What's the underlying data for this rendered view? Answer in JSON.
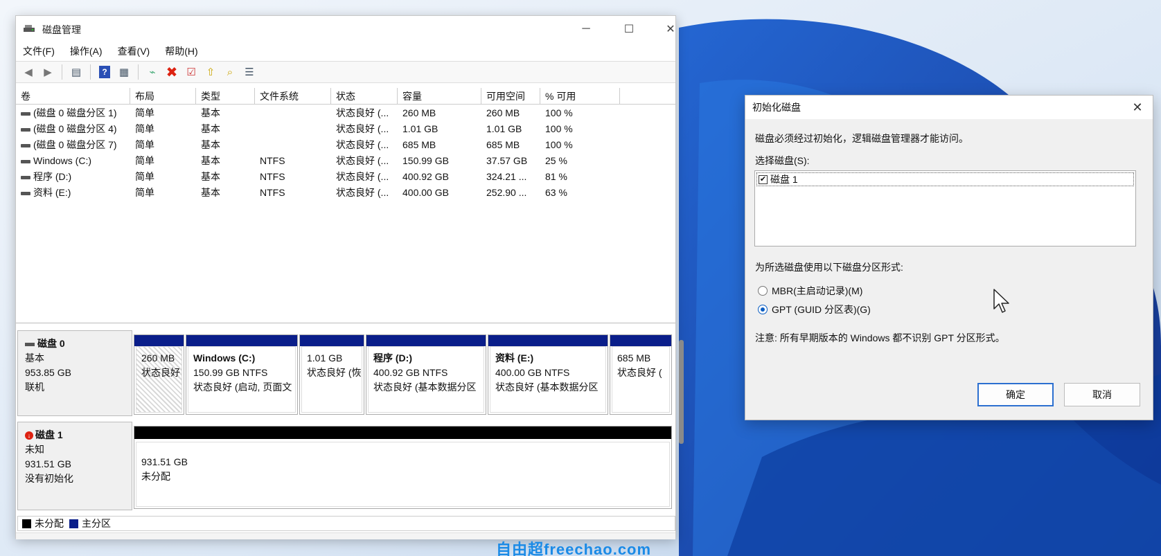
{
  "window": {
    "title": "磁盘管理",
    "controls": {
      "minimize": "─",
      "maximize": "☐",
      "close": "✕"
    }
  },
  "menu": [
    "文件(F)",
    "操作(A)",
    "查看(V)",
    "帮助(H)"
  ],
  "toolbar_icons": [
    "back-icon",
    "forward-icon",
    "console-tree-icon",
    "help-icon",
    "properties-icon",
    "connect-icon",
    "delete-icon",
    "check-icon",
    "import-icon",
    "search-icon",
    "list-icon"
  ],
  "columns": [
    "卷",
    "布局",
    "类型",
    "文件系统",
    "状态",
    "容量",
    "可用空间",
    "% 可用"
  ],
  "volumes": [
    {
      "name": "(磁盘 0 磁盘分区 1)",
      "layout": "简单",
      "type": "基本",
      "fs": "",
      "status": "状态良好 (...",
      "capacity": "260 MB",
      "free": "260 MB",
      "pct": "100 %"
    },
    {
      "name": "(磁盘 0 磁盘分区 4)",
      "layout": "简单",
      "type": "基本",
      "fs": "",
      "status": "状态良好 (...",
      "capacity": "1.01 GB",
      "free": "1.01 GB",
      "pct": "100 %"
    },
    {
      "name": "(磁盘 0 磁盘分区 7)",
      "layout": "简单",
      "type": "基本",
      "fs": "",
      "status": "状态良好 (...",
      "capacity": "685 MB",
      "free": "685 MB",
      "pct": "100 %"
    },
    {
      "name": "Windows (C:)",
      "layout": "简单",
      "type": "基本",
      "fs": "NTFS",
      "status": "状态良好 (...",
      "capacity": "150.99 GB",
      "free": "37.57 GB",
      "pct": "25 %"
    },
    {
      "name": "程序 (D:)",
      "layout": "简单",
      "type": "基本",
      "fs": "NTFS",
      "status": "状态良好 (...",
      "capacity": "400.92 GB",
      "free": "324.21 ...",
      "pct": "81 %"
    },
    {
      "name": "资料 (E:)",
      "layout": "简单",
      "type": "基本",
      "fs": "NTFS",
      "status": "状态良好 (...",
      "capacity": "400.00 GB",
      "free": "252.90 ...",
      "pct": "63 %"
    }
  ],
  "disk0": {
    "name": "磁盘 0",
    "kind": "基本",
    "size": "953.85 GB",
    "state": "联机",
    "partitions": [
      {
        "name": "",
        "line1": "260 MB",
        "line2": "状态良好"
      },
      {
        "name": "Windows (C:)",
        "line1": "150.99 GB NTFS",
        "line2": "状态良好 (启动, 页面文"
      },
      {
        "name": "",
        "line1": "1.01 GB",
        "line2": "状态良好 (恢"
      },
      {
        "name": "程序 (D:)",
        "line1": "400.92 GB NTFS",
        "line2": "状态良好 (基本数据分区"
      },
      {
        "name": "资料 (E:)",
        "line1": "400.00 GB NTFS",
        "line2": "状态良好 (基本数据分区"
      },
      {
        "name": "",
        "line1": "685 MB",
        "line2": "状态良好 ("
      }
    ]
  },
  "disk1": {
    "name": "磁盘 1",
    "kind": "未知",
    "size": "931.51 GB",
    "state": "没有初始化",
    "partition": {
      "line1": "931.51 GB",
      "line2": "未分配"
    }
  },
  "legend": {
    "unallocated": "未分配",
    "primary": "主分区",
    "unallocated_color": "#000000",
    "primary_color": "#0a1e8a"
  },
  "dialog": {
    "title": "初始化磁盘",
    "close": "✕",
    "intro": "磁盘必须经过初始化，逻辑磁盘管理器才能访问。",
    "select_label": "选择磁盘(S):",
    "disk_item": "磁盘 1",
    "disk_checked": "✔",
    "partition_style_label": "为所选磁盘使用以下磁盘分区形式:",
    "mbr": "MBR(主启动记录)(M)",
    "gpt": "GPT (GUID 分区表)(G)",
    "note": "注意: 所有早期版本的 Windows 都不识别 GPT 分区形式。",
    "ok": "确定",
    "cancel": "取消"
  },
  "watermark": "自由超freechao.com"
}
